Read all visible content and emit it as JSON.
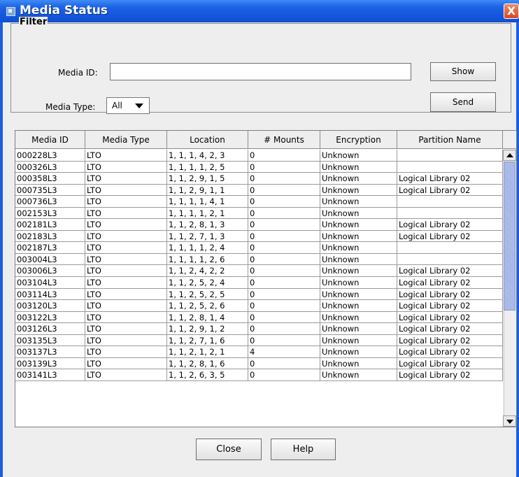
{
  "window": {
    "title": "Media Status",
    "close_glyph": "X",
    "title_icon": "app-window-icon"
  },
  "filter": {
    "legend": "Filter",
    "media_id_label": "Media ID:",
    "media_id_value": "",
    "media_type_label": "Media Type:",
    "media_type_value": "All",
    "show_label": "Show",
    "send_label": "Send"
  },
  "table": {
    "columns": [
      "Media ID",
      "Media Type",
      "Location",
      "# Mounts",
      "Encryption",
      "Partition Name"
    ],
    "rows": [
      [
        "000228L3",
        "LTO",
        "1, 1, 1, 4, 2, 3",
        "0",
        "Unknown",
        ""
      ],
      [
        "000326L3",
        "LTO",
        "1, 1, 1, 1, 2, 5",
        "0",
        "Unknown",
        ""
      ],
      [
        "000358L3",
        "LTO",
        "1, 1, 2, 9, 1, 5",
        "0",
        "Unknown",
        "Logical Library 02"
      ],
      [
        "000735L3",
        "LTO",
        "1, 1, 2, 9, 1, 1",
        "0",
        "Unknown",
        "Logical Library 02"
      ],
      [
        "000736L3",
        "LTO",
        "1, 1, 1, 1, 4, 1",
        "0",
        "Unknown",
        ""
      ],
      [
        "002153L3",
        "LTO",
        "1, 1, 1, 1, 2, 1",
        "0",
        "Unknown",
        ""
      ],
      [
        "002181L3",
        "LTO",
        "1, 1, 2, 8, 1, 3",
        "0",
        "Unknown",
        "Logical Library 02"
      ],
      [
        "002183L3",
        "LTO",
        "1, 1, 2, 7, 1, 3",
        "0",
        "Unknown",
        "Logical Library 02"
      ],
      [
        "002187L3",
        "LTO",
        "1, 1, 1, 1, 2, 4",
        "0",
        "Unknown",
        ""
      ],
      [
        "003004L3",
        "LTO",
        "1, 1, 1, 1, 2, 6",
        "0",
        "Unknown",
        ""
      ],
      [
        "003006L3",
        "LTO",
        "1, 1, 2, 4, 2, 2",
        "0",
        "Unknown",
        "Logical Library 02"
      ],
      [
        "003104L3",
        "LTO",
        "1, 1, 2, 5, 2, 4",
        "0",
        "Unknown",
        "Logical Library 02"
      ],
      [
        "003114L3",
        "LTO",
        "1, 1, 2, 5, 2, 5",
        "0",
        "Unknown",
        "Logical Library 02"
      ],
      [
        "003120L3",
        "LTO",
        "1, 1, 2, 5, 2, 6",
        "0",
        "Unknown",
        "Logical Library 02"
      ],
      [
        "003122L3",
        "LTO",
        "1, 1, 2, 8, 1, 4",
        "0",
        "Unknown",
        "Logical Library 02"
      ],
      [
        "003126L3",
        "LTO",
        "1, 1, 2, 9, 1, 2",
        "0",
        "Unknown",
        "Logical Library 02"
      ],
      [
        "003135L3",
        "LTO",
        "1, 1, 2, 7, 1, 6",
        "0",
        "Unknown",
        "Logical Library 02"
      ],
      [
        "003137L3",
        "LTO",
        "1, 1, 2, 1, 2, 1",
        "4",
        "Unknown",
        "Logical Library 02"
      ],
      [
        "003139L3",
        "LTO",
        "1, 1, 2, 8, 1, 6",
        "0",
        "Unknown",
        "Logical Library 02"
      ],
      [
        "003141L3",
        "LTO",
        "1, 1, 2, 6, 3, 5",
        "0",
        "Unknown",
        "Logical Library 02"
      ]
    ]
  },
  "footer": {
    "close_label": "Close",
    "help_label": "Help"
  },
  "colors": {
    "titlebar": "#1456db",
    "client_bg": "#eeeeee",
    "close_button": "#d8471f"
  }
}
